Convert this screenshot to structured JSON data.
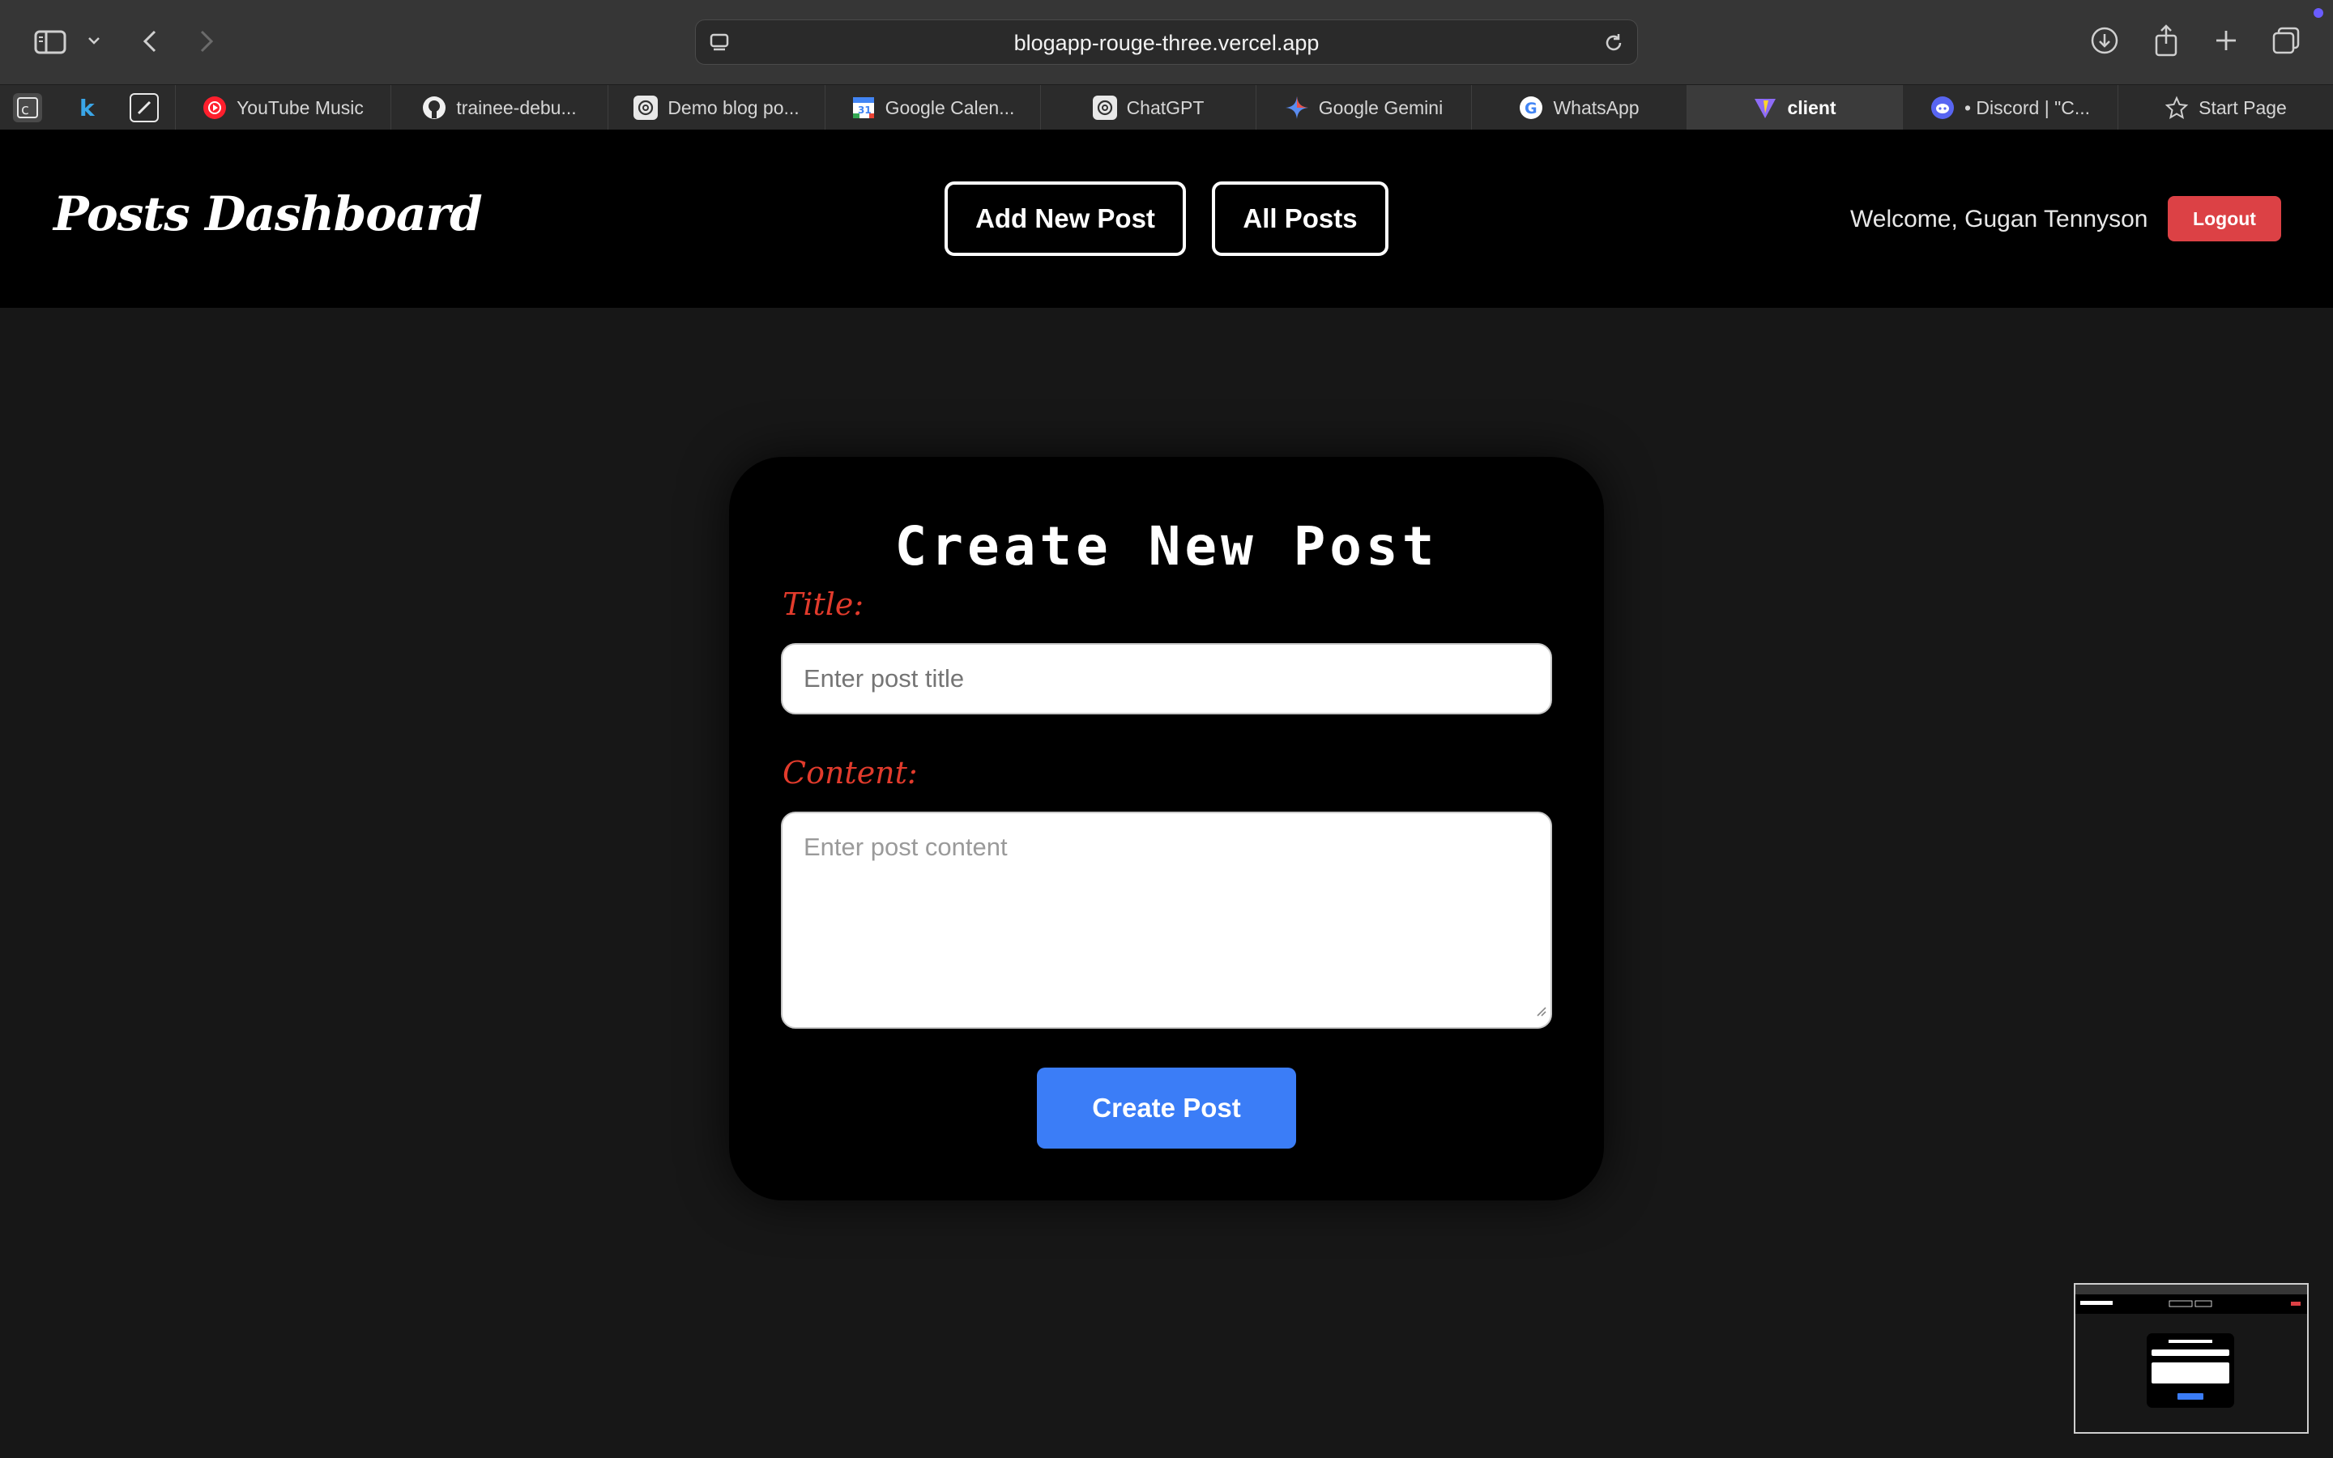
{
  "browser": {
    "url": "blogapp-rouge-three.vercel.app",
    "tabs": [
      {
        "label": "YouTube Music",
        "icon": "youtube-music-icon"
      },
      {
        "label": "trainee-debu...",
        "icon": "github-icon"
      },
      {
        "label": "Demo blog po...",
        "icon": "chatgpt-icon"
      },
      {
        "label": "Google Calen...",
        "icon": "google-calendar-icon"
      },
      {
        "label": "ChatGPT",
        "icon": "chatgpt-icon"
      },
      {
        "label": "Google Gemini",
        "icon": "gemini-icon"
      },
      {
        "label": "WhatsApp",
        "icon": "google-icon"
      },
      {
        "label": "client",
        "icon": "vite-icon",
        "active": true
      },
      {
        "label": "• Discord | \"C...",
        "icon": "discord-icon"
      },
      {
        "label": "Start Page",
        "icon": "star-icon"
      }
    ],
    "pinned_tabs": [
      "pinned-app-icon",
      "k-app-icon",
      "pen-app-icon"
    ]
  },
  "header": {
    "brand": "Posts Dashboard",
    "nav": {
      "add_new_post": "Add New Post",
      "all_posts": "All Posts"
    },
    "welcome": "Welcome, Gugan Tennyson",
    "logout": "Logout"
  },
  "form": {
    "heading": "Create New Post",
    "title_label": "Title:",
    "title_placeholder": "Enter post title",
    "content_label": "Content:",
    "content_placeholder": "Enter post content",
    "submit": "Create Post"
  },
  "colors": {
    "accent_blue": "#3b7df7",
    "logout_red": "#dc4145",
    "label_red": "#e23b2c",
    "page_bg": "#171717",
    "header_bg": "#000000"
  }
}
